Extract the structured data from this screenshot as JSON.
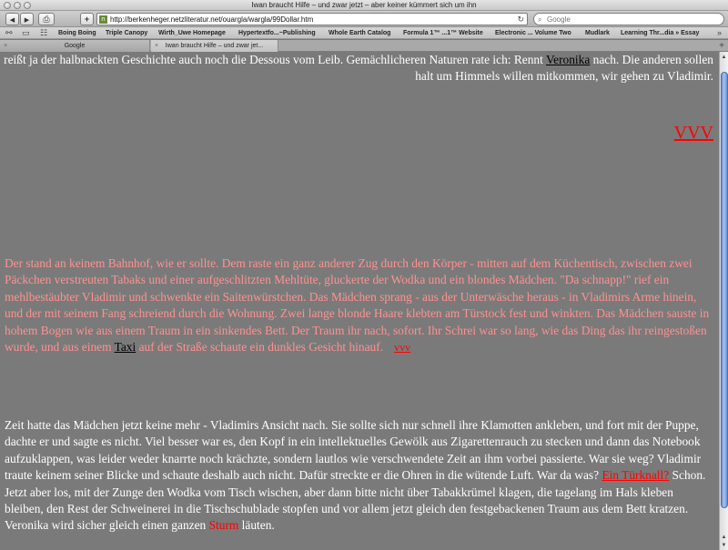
{
  "window": {
    "title": "Iwan braucht Hilfe – und zwar jetzt – aber keiner kümmert sich um ihn"
  },
  "toolbar": {
    "back_icon": "◀",
    "forward_icon": "▶",
    "print_icon": "⎙",
    "add_icon": "+",
    "url": "http://berkenheger.netzliteratur.net/ouargla/wargla/99Dollar.htm",
    "favicon": "n",
    "reload_icon": "↻",
    "search_placeholder": "Google"
  },
  "bookmarks": {
    "items": [
      "Boing Boing",
      "Triple Canopy",
      "Wirth_Uwe Homepage",
      "Hypertextfo...~Publishing",
      "Whole Earth Catalog",
      "Formula 1™ ...1™ Website",
      "Electronic ... Volume Two",
      "Mudlark",
      "Learning Thr...dia » Essay"
    ]
  },
  "tabs": [
    {
      "label": "Google",
      "active": false
    },
    {
      "label": "Iwan braucht Hilfe – und zwar jet...",
      "active": true
    }
  ],
  "content": {
    "p1": {
      "text": "reißt ja der halbnackten Geschichte auch noch die Dessous vom Leib. Gemächlicheren Naturen rate ich: Rennt ",
      "link": "Veronika",
      "text_after": " nach. Die anderen sollen halt um Himmels willen mitkommen, wir gehen zu Vladimir."
    },
    "vvv_big": "VVV",
    "p2": {
      "text": "Der stand an keinem Bahnhof, wie er sollte. Dem raste ein ganz anderer Zug durch den Körper - mitten auf dem Küchentisch, zwischen zwei Päckchen verstreuten Tabaks und einer aufgeschlitzten Mehltüte, gluckerte der Wodka und ein blondes Mädchen. \"Da schnapp!\" rief ein mehlbestäubter Vladimir und schwenkte ein Saitenwürstchen. Das Mädchen sprang - aus der Unterwäsche heraus - in Vladimirs Arme hinein, und der mit seinem Fang schreiend durch die Wohnung. Zwei lange blonde Haare klebten am Türstock fest und winkten. Das Mädchen sauste in hohem Bogen wie aus einem Traum in ein sinkendes Bett. Der Traum ihr nach, sofort. Ihr Schrei war so lang, wie das Ding das ihr reingestoßen wurde, und aus einem ",
      "link": "Taxi",
      "text_after": " auf der Straße schaute ein dunkles Gesicht hinauf.",
      "vvv_small": "vvv"
    },
    "p3": {
      "text": "Zeit hatte das Mädchen jetzt keine mehr - Vladimirs Ansicht nach. Sie sollte sich nur schnell ihre Klamotten ankleben, und fort mit der Puppe, dachte er und sagte es nicht. Viel besser war es, den Kopf in ein intellektuelles Gewölk aus Zigarettenrauch zu stecken und dann das Notebook aufzuklappen, was leider weder knarrte noch krächzte, sondern lautlos wie verschwendete Zeit an ihm vorbei passierte. War sie weg? Vladimir traute keinem seiner Blicke und schaute deshalb auch nicht. Dafür streckte er die Ohren in die wütende Luft. War da was? ",
      "link": "Ein Türknall?",
      "text_mid": " Schon. Jetzt aber los, mit der Zunge den Wodka vom Tisch wischen, aber dann bitte nicht über Tabakkrümel klagen, die tagelang im Hals kleben bleiben, den Rest der Schweinerei in die Tischschublade stopfen und vor allem jetzt gleich den festgebackenen Traum aus dem Bett kratzen. Veronika wird sicher gleich einen ganzen ",
      "red_word": "Sturm",
      "text_after": " läuten."
    }
  },
  "colors": {
    "page_bg": "#7a7a7a",
    "text_white": "#ffffff",
    "text_pink": "#ff9191",
    "link_red": "#ff0000",
    "link_black": "#000000"
  }
}
